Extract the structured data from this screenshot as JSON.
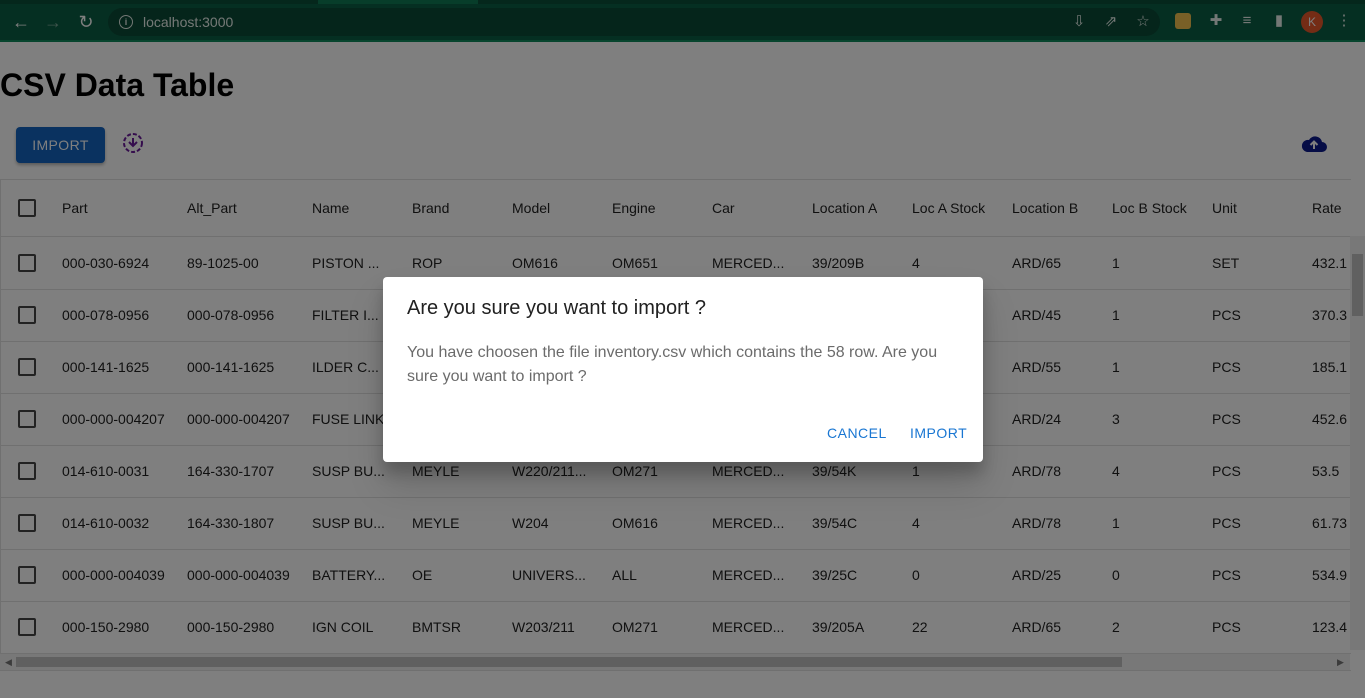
{
  "browser": {
    "url": "localhost:3000",
    "avatar_initial": "K"
  },
  "page": {
    "title": "CSV Data Table",
    "import_label": "IMPORT"
  },
  "table": {
    "headers": [
      "Part",
      "Alt_Part",
      "Name",
      "Brand",
      "Model",
      "Engine",
      "Car",
      "Location A",
      "Loc A Stock",
      "Location B",
      "Loc B Stock",
      "Unit",
      "Rate"
    ],
    "rows": [
      [
        "000-030-6924",
        "89-1025-00",
        "PISTON ...",
        "ROP",
        "OM616",
        "OM651",
        "MERCED...",
        "39/209B",
        "4",
        "ARD/65",
        "1",
        "SET",
        "432.1"
      ],
      [
        "000-078-0956",
        "000-078-0956",
        "FILTER I...",
        "",
        "",
        "",
        "",
        "",
        "",
        "ARD/45",
        "1",
        "PCS",
        "370.3"
      ],
      [
        "000-141-1625",
        "000-141-1625",
        "ILDER C...",
        "",
        "",
        "",
        "",
        "",
        "",
        "ARD/55",
        "1",
        "PCS",
        "185.1"
      ],
      [
        "000-000-004207",
        "000-000-004207",
        "FUSE LINK",
        "",
        "",
        "",
        "",
        "",
        "",
        "ARD/24",
        "3",
        "PCS",
        "452.6"
      ],
      [
        "014-610-0031",
        "164-330-1707",
        "SUSP BU...",
        "MEYLE",
        "W220/211...",
        "OM271",
        "MERCED...",
        "39/54K",
        "1",
        "ARD/78",
        "4",
        "PCS",
        "53.5"
      ],
      [
        "014-610-0032",
        "164-330-1807",
        "SUSP BU...",
        "MEYLE",
        "W204",
        "OM616",
        "MERCED...",
        "39/54C",
        "4",
        "ARD/78",
        "1",
        "PCS",
        "61.73"
      ],
      [
        "000-000-004039",
        "000-000-004039",
        "BATTERY...",
        "OE",
        "UNIVERS...",
        "ALL",
        "MERCED...",
        "39/25C",
        "0",
        "ARD/25",
        "0",
        "PCS",
        "534.9"
      ],
      [
        "000-150-2980",
        "000-150-2980",
        "IGN COIL",
        "BMTSR",
        "W203/211",
        "OM271",
        "MERCED...",
        "39/205A",
        "22",
        "ARD/65",
        "2",
        "PCS",
        "123.4"
      ]
    ]
  },
  "dialog": {
    "title": "Are you sure you want to import ?",
    "body": "You have choosen the file inventory.csv which contains the 58 row. Are you sure you want to import ?",
    "cancel_label": "CANCEL",
    "import_label": "IMPORT"
  },
  "colors": {
    "chrome": "#0b5e44",
    "primary": "#1565c0",
    "dialog_action": "#1976d2",
    "cloud_icon": "#0d1b8c",
    "download_icon": "#6a1b9a"
  }
}
